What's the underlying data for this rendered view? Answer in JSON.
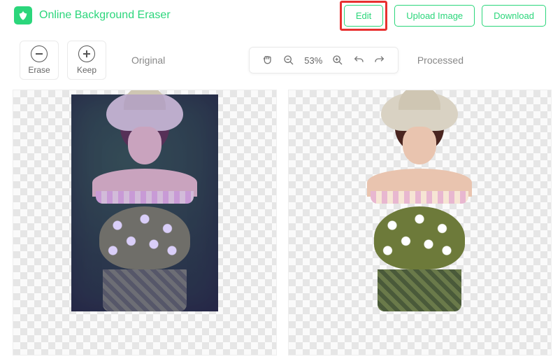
{
  "header": {
    "title": "Online Background Eraser",
    "edit": "Edit",
    "upload": "Upload Image",
    "download": "Download"
  },
  "tools": {
    "erase": "Erase",
    "keep": "Keep"
  },
  "labels": {
    "original": "Original",
    "processed": "Processed"
  },
  "zoom": {
    "value": "53%"
  }
}
